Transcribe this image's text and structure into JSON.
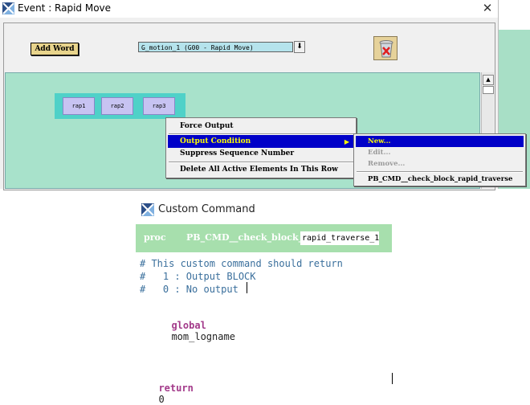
{
  "event_window": {
    "title": "Event : Rapid Move",
    "close_glyph": "✕",
    "add_word_label": "Add Word",
    "motion_select_value": "G_motion_1 (G00 - Rapid Move)",
    "dropdown_glyph": "⬇",
    "words": [
      "rap1",
      "rap2",
      "rap3"
    ]
  },
  "context_menu": {
    "items": [
      "Force Output",
      "Output Condition",
      "Suppress Sequence Number",
      "Delete All Active Elements In This Row"
    ],
    "arrow_glyph": "▶"
  },
  "submenu": {
    "items": [
      "New...",
      "Edit...",
      "Remove...",
      "PB_CMD__check_block_rapid_traverse"
    ]
  },
  "custom_command": {
    "title": "Custom Command",
    "proc_keyword": "proc",
    "proc_prefix": "PB_CMD__check_block_",
    "proc_name": "rapid_traverse_1",
    "comment_lines": [
      "# This custom command should return",
      "#   1 : Output BLOCK",
      "#   0 : No output"
    ],
    "global_keyword": "global",
    "global_var": "mom_logname",
    "return_keyword": "return",
    "return_value": "0"
  },
  "icons": [
    "app-icon",
    "close-icon",
    "dropdown-icon",
    "trash-icon",
    "submenu-arrow-icon"
  ],
  "colors": {
    "highlight": "#0000c8",
    "highlight_text": "#ffff00",
    "green_area": "#a8e2cb",
    "word_row": "#4fd1c8",
    "word": "#c7c3f2",
    "proc_bar": "#a7dfad"
  }
}
